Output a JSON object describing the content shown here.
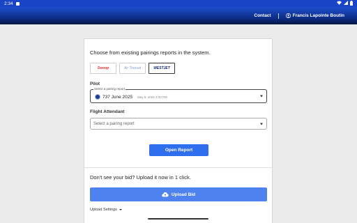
{
  "status_bar": {
    "time": "2:34"
  },
  "header": {
    "contact": "Contact",
    "user_name": "Francis Lapointe Boutin"
  },
  "card": {
    "heading": "Choose from existing pairings reports in the system.",
    "logos": [
      {
        "name": "Swoop",
        "text": "Swoop"
      },
      {
        "name": "Air Transat",
        "text": "Air Transat"
      },
      {
        "name": "WestJet",
        "text": "WESTJET"
      }
    ],
    "pilot": {
      "label": "Pilot",
      "field_label": "Select a pairing report",
      "value": "737 June 2025",
      "date": "May 8, 2025 3:33 PM"
    },
    "flight_attendant": {
      "label": "Flight Attendant",
      "placeholder": "Select a pairing report"
    },
    "open_report": "Open Report",
    "bid_prompt": "Don't see your bid? Upload it now in 1 click.",
    "upload_bid": "Upload Bid",
    "upload_settings": "Upload Settings"
  },
  "colors": {
    "accent": "#2f6fee",
    "header": "#0b2a7e"
  }
}
